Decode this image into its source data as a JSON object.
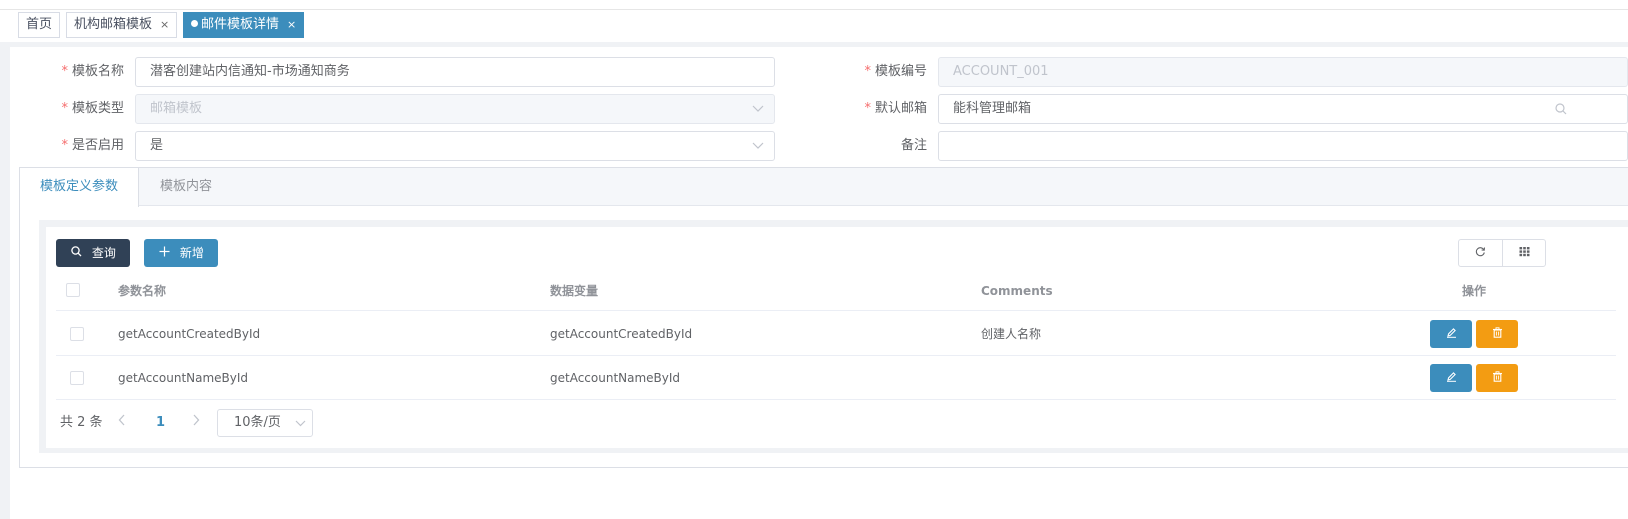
{
  "tags": [
    {
      "label": "首页",
      "closable": false,
      "active": false
    },
    {
      "label": "机构邮箱模板",
      "closable": true,
      "active": false
    },
    {
      "label": "邮件模板详情",
      "closable": true,
      "active": true
    }
  ],
  "tag_close_glyph": "×",
  "form": {
    "template_name": {
      "label": "模板名称",
      "value": "潜客创建站内信通知-市场通知商务",
      "required": true
    },
    "template_code": {
      "label": "模板编号",
      "value": "ACCOUNT_001",
      "required": true
    },
    "template_type": {
      "label": "模板类型",
      "value": "邮箱模板",
      "required": true
    },
    "default_mailbox": {
      "label": "默认邮箱",
      "value": "能科管理邮箱",
      "required": true
    },
    "enabled": {
      "label": "是否启用",
      "value": "是",
      "required": true
    },
    "remark": {
      "label": "备注",
      "value": ""
    }
  },
  "required_mark": "*",
  "tabs": [
    {
      "label": "模板定义参数",
      "active": true
    },
    {
      "label": "模板内容",
      "active": false
    }
  ],
  "toolbar": {
    "query_label": "查询",
    "add_label": "新增"
  },
  "table": {
    "columns": [
      "参数名称",
      "数据变量",
      "Comments",
      "操作"
    ],
    "rows": [
      {
        "param_name": "getAccountCreatedById",
        "data_variable": "getAccountCreatedById",
        "comments": "创建人名称"
      },
      {
        "param_name": "getAccountNameById",
        "data_variable": "getAccountNameById",
        "comments": ""
      }
    ]
  },
  "pagination": {
    "total_text": "共 2 条",
    "current_page": "1",
    "page_size": "10条/页"
  },
  "colors": {
    "primary": "#3c8dbc",
    "dark": "#304156",
    "warning": "#f39c12",
    "required": "#f56c6c"
  }
}
